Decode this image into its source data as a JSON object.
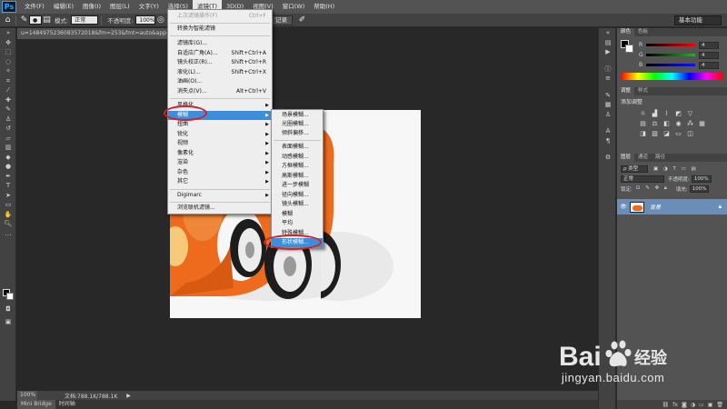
{
  "app": {
    "logo": "Ps"
  },
  "menubar": {
    "items": [
      "文件(F)",
      "编辑(E)",
      "图像(I)",
      "图层(L)",
      "文字(Y)",
      "选择(S)",
      "滤镜(T)",
      "3D(D)",
      "视图(V)",
      "窗口(W)",
      "帮助(H)"
    ],
    "active_index": 6
  },
  "options": {
    "mode_label": "模式:",
    "mode_value": "正常",
    "opacity_label": "不透明度:",
    "opacity_value": "100%",
    "record_label": "记录",
    "workspace": "基本功能"
  },
  "document": {
    "tab_title": "u=1484975236083572018&fm=253&fmt=auto&app=138",
    "zoom": "100%",
    "doc_info": "文档:788.1K/788.1K"
  },
  "bottom_tabs": [
    "Mini Bridge",
    "时间轴"
  ],
  "filter_menu": {
    "items": [
      {
        "label": "上次滤镜操作(F)",
        "shortcut": "Ctrl+F",
        "disabled": true
      },
      {
        "sep": true
      },
      {
        "label": "转换为智能滤镜"
      },
      {
        "sep": true
      },
      {
        "label": "滤镜库(G)..."
      },
      {
        "label": "自适应广角(A)...",
        "shortcut": "Shift+Ctrl+A"
      },
      {
        "label": "镜头校正(R)...",
        "shortcut": "Shift+Ctrl+R"
      },
      {
        "label": "液化(L)...",
        "shortcut": "Shift+Ctrl+X"
      },
      {
        "label": "油画(O)..."
      },
      {
        "label": "消失点(V)...",
        "shortcut": "Alt+Ctrl+V"
      },
      {
        "sep": true
      },
      {
        "label": "风格化",
        "submenu": true
      },
      {
        "label": "模糊",
        "submenu": true,
        "highlighted": true
      },
      {
        "label": "扭曲",
        "submenu": true
      },
      {
        "label": "锐化",
        "submenu": true
      },
      {
        "label": "视频",
        "submenu": true
      },
      {
        "label": "像素化",
        "submenu": true
      },
      {
        "label": "渲染",
        "submenu": true
      },
      {
        "label": "杂色",
        "submenu": true
      },
      {
        "label": "其它",
        "submenu": true
      },
      {
        "sep": true
      },
      {
        "label": "Digimarc",
        "submenu": true
      },
      {
        "sep": true
      },
      {
        "label": "浏览联机滤镜..."
      }
    ]
  },
  "blur_submenu": {
    "items": [
      {
        "label": "场景模糊..."
      },
      {
        "label": "光圈模糊..."
      },
      {
        "label": "倾斜偏移..."
      },
      {
        "sep": true
      },
      {
        "label": "表面模糊..."
      },
      {
        "label": "动感模糊..."
      },
      {
        "label": "方框模糊..."
      },
      {
        "label": "高斯模糊..."
      },
      {
        "label": "进一步模糊"
      },
      {
        "label": "径向模糊..."
      },
      {
        "label": "镜头模糊..."
      },
      {
        "label": "模糊"
      },
      {
        "label": "平均"
      },
      {
        "label": "特殊模糊..."
      },
      {
        "label": "形状模糊...",
        "highlighted": true
      }
    ]
  },
  "color_panel": {
    "tabs": [
      "颜色",
      "色板"
    ],
    "channels": [
      {
        "name": "R",
        "value": "4",
        "color": "#d42a2a"
      },
      {
        "name": "G",
        "value": "4",
        "color": "#2fa52f"
      },
      {
        "name": "B",
        "value": "4",
        "color": "#2a47c9"
      }
    ]
  },
  "adjust_panel": {
    "tabs": [
      "调整",
      "样式"
    ],
    "title": "添加调整"
  },
  "layers_panel": {
    "tabs": [
      "图层",
      "通道",
      "路径"
    ],
    "kind_label": "类型",
    "blend_mode": "正常",
    "opacity_label": "不透明度:",
    "opacity_value": "100%",
    "lock_label": "锁定:",
    "fill_label": "填充:",
    "fill_value": "100%",
    "layer_name": "背景"
  },
  "watermark": {
    "brand": "Bai",
    "brand2": "经验",
    "url": "jingyan.baidu.com"
  },
  "colors": {
    "highlight": "#3c8ddb",
    "annotation_ring": "#d71f28",
    "car_orange": "#ee6a1c",
    "layer_selected": "#6b8eb8"
  }
}
